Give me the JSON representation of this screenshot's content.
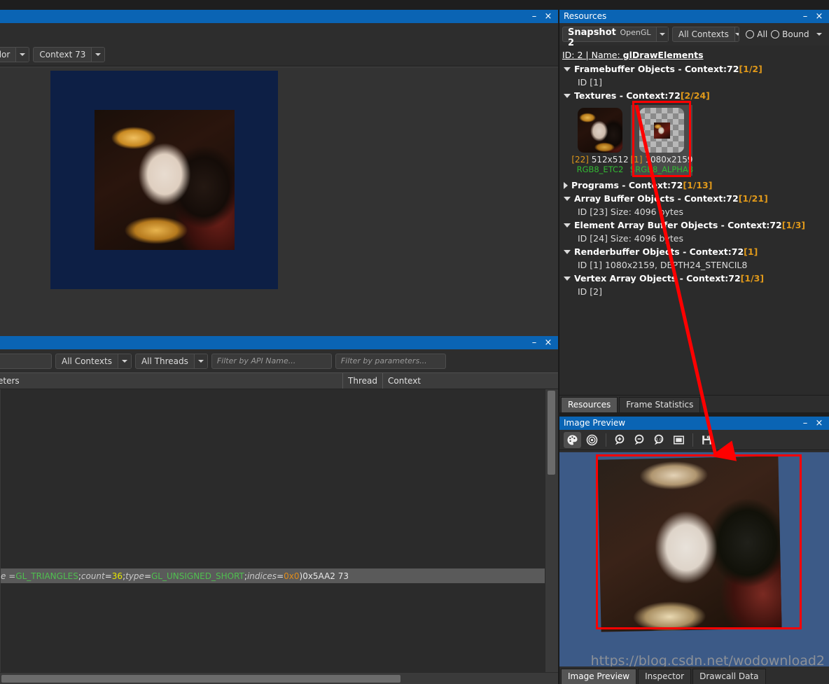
{
  "window": {
    "minimize_label": "–",
    "close_label": "×"
  },
  "framebuffer_panel": {
    "title": "",
    "color_select": {
      "value": "Color"
    },
    "context_select": {
      "value": "Context 73"
    },
    "canvas": {
      "background_color": "#0d1f45"
    }
  },
  "api_trace_panel": {
    "title": "",
    "contexts_select": {
      "value": "All Contexts"
    },
    "threads_select": {
      "value": "All Threads"
    },
    "filter_api": {
      "placeholder": "Filter by API Name..."
    },
    "filter_params": {
      "placeholder": "Filter by parameters..."
    },
    "columns": [
      "eters",
      "Thread",
      "Context"
    ],
    "selected_row": {
      "segments": [
        {
          "text": "e = ",
          "style": "italic"
        },
        {
          "text": "GL_TRIANGLES",
          "style": "green"
        },
        {
          "text": "; ",
          "style": "plain"
        },
        {
          "text": "count",
          "style": "italic"
        },
        {
          "text": " = ",
          "style": "plain"
        },
        {
          "text": "36",
          "style": "yellow"
        },
        {
          "text": "; ",
          "style": "plain"
        },
        {
          "text": "type",
          "style": "italic"
        },
        {
          "text": " = ",
          "style": "plain"
        },
        {
          "text": "GL_UNSIGNED_SHORT",
          "style": "green"
        },
        {
          "text": "; ",
          "style": "plain"
        },
        {
          "text": "indices",
          "style": "italic"
        },
        {
          "text": " = ",
          "style": "plain"
        },
        {
          "text": "0x0",
          "style": "orange"
        },
        {
          "text": " )",
          "style": "plain"
        },
        {
          "text": "   0x5AA2  73",
          "style": "plain"
        }
      ]
    }
  },
  "resources_panel": {
    "title": "Resources",
    "snapshot": {
      "label": "Snapshot 2",
      "api": "OpenGL"
    },
    "contexts_select": {
      "value": "All Contexts"
    },
    "radio_all": "All",
    "radio_bound": "Bound",
    "draw_header": {
      "prefix": "ID: 2 | Name: ",
      "name": "glDrawElements"
    },
    "tree": [
      {
        "type": "node",
        "expanded": true,
        "label": "Framebuffer Objects - Context:72 ",
        "count": "[1/2]"
      },
      {
        "type": "leaf",
        "label": "ID [1]"
      },
      {
        "type": "node",
        "expanded": true,
        "label": "Textures - Context:72 ",
        "count": "[2/24]"
      },
      {
        "type": "textures"
      },
      {
        "type": "node",
        "expanded": false,
        "label": "Programs - Context:72 ",
        "count": "[1/13]"
      },
      {
        "type": "node",
        "expanded": true,
        "label": "Array Buffer Objects - Context:72 ",
        "count": "[1/21]"
      },
      {
        "type": "leaf",
        "label": "ID [23] Size: 4096 bytes"
      },
      {
        "type": "node",
        "expanded": true,
        "label": "Element Array Buffer Objects - Context:72 ",
        "count": "[1/3]"
      },
      {
        "type": "leaf",
        "label": "ID [24] Size: 4096 bytes"
      },
      {
        "type": "node",
        "expanded": true,
        "label": "Renderbuffer Objects - Context:72 ",
        "count": "[1]"
      },
      {
        "type": "leaf",
        "label": "ID [1] 1080x2159, DEPTH24_STENCIL8"
      },
      {
        "type": "node",
        "expanded": true,
        "label": "Vertex Array Objects - Context:72 ",
        "count": "[1/3]"
      },
      {
        "type": "leaf",
        "label": "ID [2]"
      }
    ],
    "textures": [
      {
        "id": "[22]",
        "size": "512x512",
        "format": "RGB8_ETC2",
        "selected": false,
        "thumb": "portrait"
      },
      {
        "id": "[1]",
        "size": "1080x2159",
        "format": "SRGB8_ALPHA8",
        "selected": true,
        "thumb": "checker"
      }
    ],
    "tabs": [
      {
        "label": "Resources",
        "active": true
      },
      {
        "label": "Frame Statistics",
        "active": false
      }
    ]
  },
  "image_preview_panel": {
    "title": "Image Preview",
    "toolbar": [
      {
        "name": "channels-icon",
        "active": true
      },
      {
        "name": "alpha-target-icon",
        "active": false
      },
      {
        "name": "zoom-in-icon",
        "active": false
      },
      {
        "name": "zoom-out-icon",
        "active": false
      },
      {
        "name": "zoom-actual-icon",
        "active": false
      },
      {
        "name": "fit-to-window-icon",
        "active": false
      },
      {
        "name": "save-icon",
        "active": false
      }
    ],
    "view_background_color": "#3c5a87",
    "tabs": [
      {
        "label": "Image Preview",
        "active": true
      },
      {
        "label": "Inspector",
        "active": false
      },
      {
        "label": "Drawcall Data",
        "active": false
      }
    ]
  },
  "annotation": {
    "arrow_color": "#ff0000",
    "highlight_color": "#ff0000"
  },
  "watermark": {
    "text": "https://blog.csdn.net/wodownload2"
  }
}
